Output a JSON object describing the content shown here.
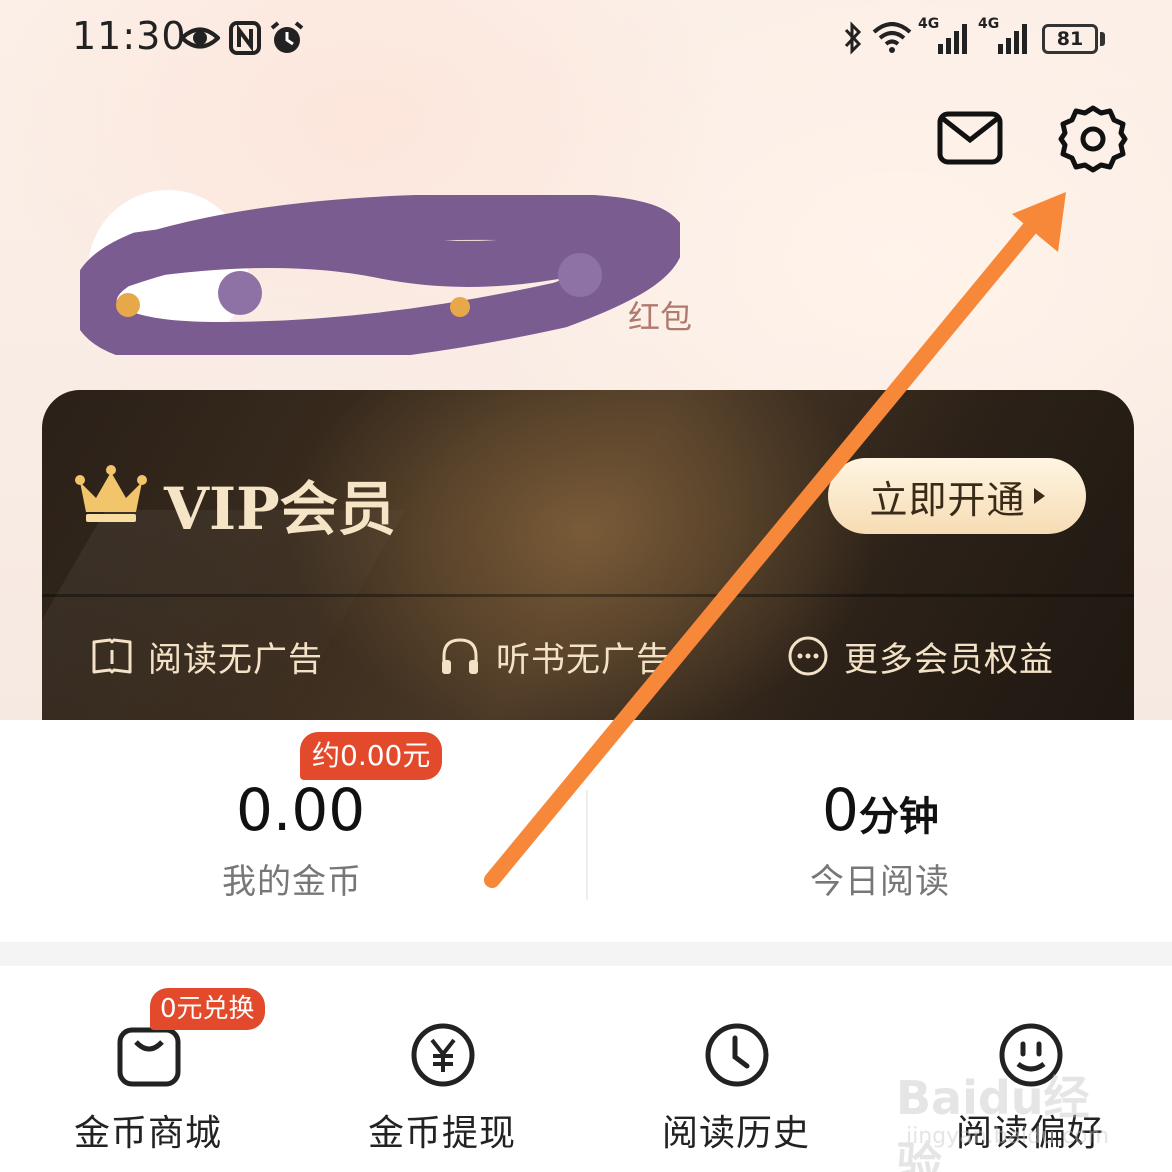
{
  "status_bar": {
    "time": "11:30",
    "net1": "4G",
    "net2": "4G",
    "battery": "81"
  },
  "profile": {
    "username": "",
    "promo_text": "红包"
  },
  "vip": {
    "title": "VIP会员",
    "button_label": "立即开通",
    "benefits": [
      {
        "label": "阅读无广告",
        "icon": "book-icon"
      },
      {
        "label": "听书无广告",
        "icon": "headphones-icon"
      },
      {
        "label": "更多会员权益",
        "icon": "more-icon"
      }
    ]
  },
  "stats": {
    "coins": {
      "value": "0.00",
      "label": "我的金币",
      "badge": "约0.00元"
    },
    "reading": {
      "value": "0",
      "unit": "分钟",
      "label": "今日阅读"
    }
  },
  "shortcuts": [
    {
      "label": "金币商城",
      "icon": "shopping-bag-icon",
      "badge": "0元兑换"
    },
    {
      "label": "金币提现",
      "icon": "yuan-coin-icon"
    },
    {
      "label": "阅读历史",
      "icon": "clock-icon"
    },
    {
      "label": "阅读偏好",
      "icon": "smiley-icon"
    }
  ],
  "watermark": {
    "text": "Baidu经验",
    "sub": "jingyan.baidu.com"
  },
  "colors": {
    "accent_red": "#e24a2b",
    "annotation_arrow": "#f7883a",
    "vip_gold": "#f5e4c6",
    "vip_card_dark": "#2a2018"
  }
}
